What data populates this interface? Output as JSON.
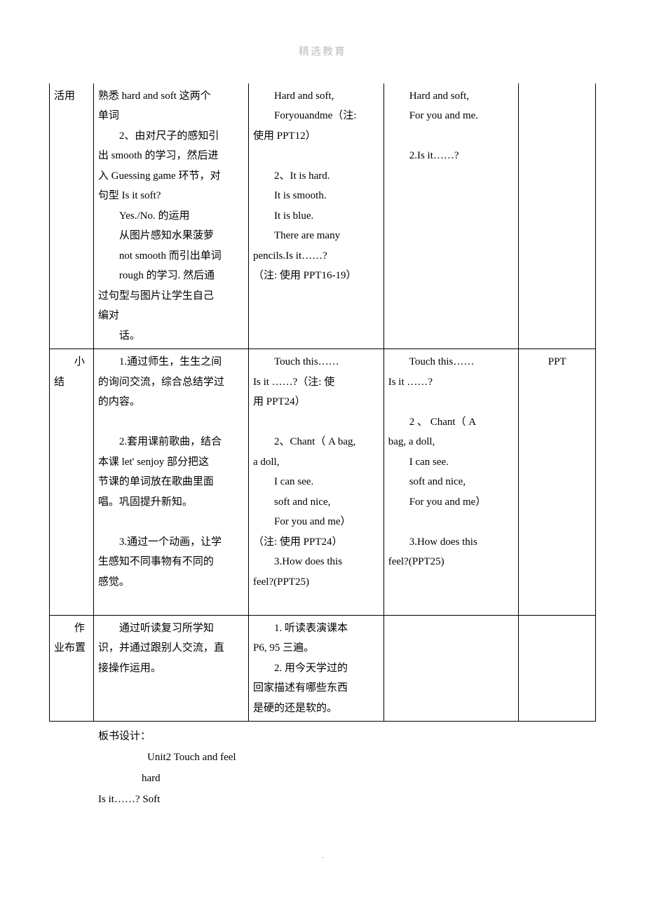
{
  "header": "精选教育",
  "page_dot": ".",
  "table": {
    "row1": {
      "c1": "活用",
      "c2_l1": "熟悉 hard and soft 这两个",
      "c2_l2": "单词",
      "c2_l3": "2、由对尺子的感知引",
      "c2_l4": "出 smooth 的学习，然后进",
      "c2_l5": "入 Guessing game 环节，对",
      "c2_l6": "句型 Is it soft?",
      "c2_l7": "Yes./No. 的运用",
      "c2_l8": "从图片感知水果菠萝",
      "c2_l9": "not smooth 而引出单词",
      "c2_l10": "rough 的学习. 然后通",
      "c2_l11": "过句型与图片让学生自己",
      "c2_l12": "编对",
      "c2_l13": "话。",
      "c3_l1": "Hard and soft,",
      "c3_l2": "Foryouandme（注:",
      "c3_l3": "使用 PPT12）",
      "c3_l4": "2、It is hard.",
      "c3_l5": "It is smooth.",
      "c3_l6": "It is blue.",
      "c3_l7": "There are many",
      "c3_l8": "pencils.Is it……?",
      "c3_l9": "（注: 使用 PPT16-19）",
      "c4_l1": "Hard and soft,",
      "c4_l2": "For you and me.",
      "c4_l3": "2.Is it……?",
      "c5": ""
    },
    "row2": {
      "c1_a": "小",
      "c1_b": "结",
      "c2_l1": "1.通过师生，生生之间",
      "c2_l2": "的询问交流，综合总结学过",
      "c2_l3": "的内容。",
      "c2_l4": "2.套用课前歌曲，结合",
      "c2_l5": "本课 let' senjoy 部分把这",
      "c2_l6": "节课的单词放在歌曲里面",
      "c2_l7": "唱。巩固提升新知。",
      "c2_l8": "3.通过一个动画，让学",
      "c2_l9": "生感知不同事物有不同的",
      "c2_l10": "感觉。",
      "c3_l1": "Touch this……",
      "c3_l2": "Is it ……?（注: 使",
      "c3_l3": "用 PPT24）",
      "c3_l4": "2、Chant（ A bag,",
      "c3_l5": "a doll,",
      "c3_l6": "I can see.",
      "c3_l7": "soft and nice,",
      "c3_l8": "For you and me）",
      "c3_l9": "（注: 使用 PPT24）",
      "c3_l10": "3.How does this",
      "c3_l11": "feel?(PPT25)",
      "c4_l1": "Touch this……",
      "c4_l2": "Is it ……?",
      "c4_l3": "2 、 Chant（  A",
      "c4_l4": "bag, a doll,",
      "c4_l5": "I can see.",
      "c4_l6": "soft and nice,",
      "c4_l7": "For you and me）",
      "c4_l8": "3.How does this",
      "c4_l9": "feel?(PPT25)",
      "c5": "PPT"
    },
    "row3": {
      "c1_a": "作",
      "c1_b": "业布置",
      "c2_l1": "通过听读复习所学知",
      "c2_l2": "识，并通过跟别人交流，直",
      "c2_l3": "接操作运用。",
      "c3_l1": "1. 听读表演课本",
      "c3_l2": "P6, 95 三遍。",
      "c3_l3": "2. 用今天学过的",
      "c3_l4": "回家描述有哪些东西",
      "c3_l5": "是硬的还是软的。",
      "c4": "",
      "c5": ""
    }
  },
  "footer": {
    "l1": "板书设计：",
    "l2": "Unit2   Touch and feel",
    "l3": "hard",
    "l4": "Is it……? Soft"
  }
}
